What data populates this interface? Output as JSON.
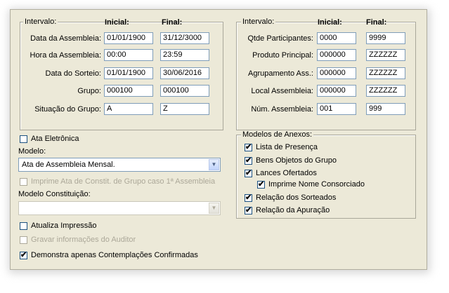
{
  "left_group": {
    "legend": "Intervalo:",
    "col_initial": "Inicial:",
    "col_final": "Final:",
    "rows": [
      {
        "label": "Data da Assembleia:",
        "initial": "01/01/1900",
        "final": "31/12/3000"
      },
      {
        "label": "Hora da Assembleia:",
        "initial": "00:00",
        "final": "23:59"
      },
      {
        "label": "Data do Sorteio:",
        "initial": "01/01/1900",
        "final": "30/06/2016"
      },
      {
        "label": "Grupo:",
        "initial": "000100",
        "final": "000100"
      },
      {
        "label": "Situação do Grupo:",
        "initial": "A",
        "final": "Z"
      }
    ]
  },
  "right_group": {
    "legend": "Intervalo:",
    "col_initial": "Inicial:",
    "col_final": "Final:",
    "rows": [
      {
        "label": "Qtde Participantes:",
        "initial": "0000",
        "final": "9999"
      },
      {
        "label": "Produto Principal:",
        "initial": "000000",
        "final": "ZZZZZZ"
      },
      {
        "label": "Agrupamento Ass.:",
        "initial": "000000",
        "final": "ZZZZZZ"
      },
      {
        "label": "Local Assembleia:",
        "initial": "000000",
        "final": "ZZZZZZ"
      },
      {
        "label": "Núm. Assembleia:",
        "initial": "001",
        "final": "999"
      }
    ]
  },
  "options": {
    "ata_eletronica": {
      "label": "Ata Eletrônica",
      "checked": false
    },
    "modelo_label": "Modelo:",
    "modelo_value": "Ata de Assembleia Mensal.",
    "imprime_ata": {
      "label": "Imprime Ata de Constit. de Grupo caso 1ª Assembleia",
      "checked": false,
      "disabled": true
    },
    "modelo_constituicao_label": "Modelo Constituição:",
    "modelo_constituicao_value": "",
    "atualiza_impressao": {
      "label": "Atualiza Impressão",
      "checked": false
    },
    "gravar_informacoes": {
      "label": "Gravar informações do Auditor",
      "checked": false,
      "disabled": true
    },
    "demonstra_apenas": {
      "label": "Demonstra apenas Contemplações Confirmadas",
      "checked": true
    }
  },
  "anexos": {
    "legend": "Modelos de Anexos:",
    "items": [
      {
        "label": "Lista de Presença",
        "checked": true
      },
      {
        "label": "Bens Objetos do Grupo",
        "checked": true
      },
      {
        "label": "Lances Ofertados",
        "checked": true
      },
      {
        "label": "Imprime Nome Consorciado",
        "checked": true
      },
      {
        "label": "Relação dos Sorteados",
        "checked": true
      },
      {
        "label": "Relação da Apuração",
        "checked": true
      }
    ]
  },
  "check_mark": "✔",
  "dropdown_arrow": "▼"
}
